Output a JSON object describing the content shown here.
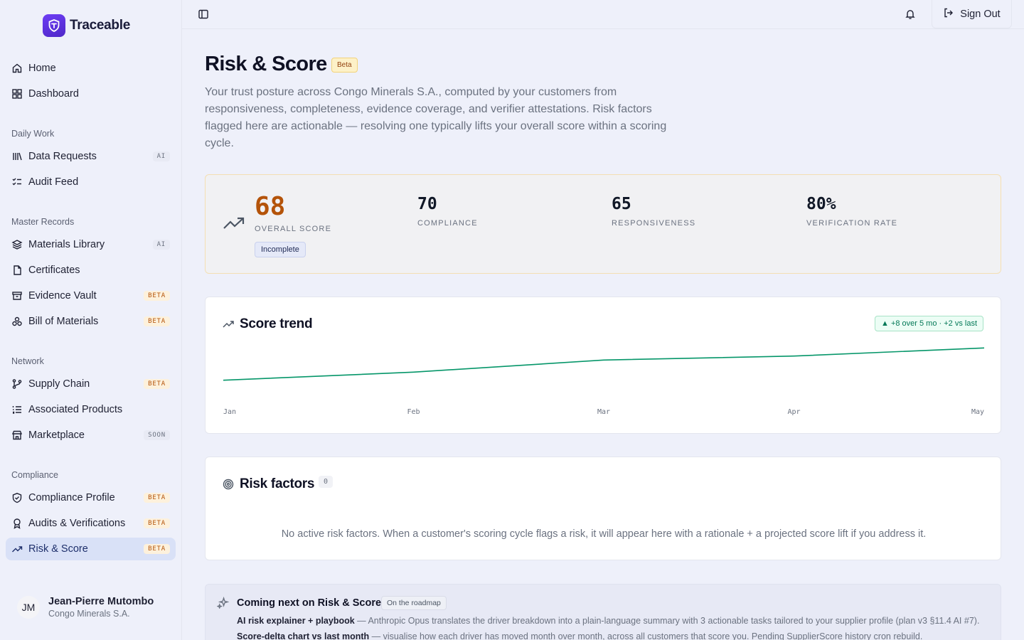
{
  "brand": {
    "name": "Traceable"
  },
  "nav": {
    "home": "Home",
    "dashboard": "Dashboard",
    "sections": {
      "daily_work": "Daily Work",
      "master_records": "Master Records",
      "network": "Network",
      "compliance": "Compliance"
    },
    "data_requests": {
      "label": "Data Requests",
      "badge": "AI"
    },
    "audit_feed": "Audit Feed",
    "materials_library": {
      "label": "Materials Library",
      "badge": "AI"
    },
    "certificates": "Certificates",
    "evidence_vault": {
      "label": "Evidence Vault",
      "badge": "BETA"
    },
    "bill_of_materials": {
      "label": "Bill of Materials",
      "badge": "BETA"
    },
    "supply_chain": {
      "label": "Supply Chain",
      "badge": "BETA"
    },
    "associated_products": "Associated Products",
    "marketplace": {
      "label": "Marketplace",
      "badge": "SOON"
    },
    "compliance_profile": {
      "label": "Compliance Profile",
      "badge": "BETA"
    },
    "audits_verifications": {
      "label": "Audits & Verifications",
      "badge": "BETA"
    },
    "risk_score": {
      "label": "Risk & Score",
      "badge": "BETA"
    }
  },
  "user": {
    "initials": "JM",
    "name": "Jean-Pierre Mutombo",
    "org": "Congo Minerals S.A."
  },
  "topbar": {
    "sign_out": "Sign Out"
  },
  "page": {
    "title": "Risk & Score",
    "title_badge": "Beta",
    "subtitle": "Your trust posture across Congo Minerals S.A., computed by your customers from responsiveness, completeness, evidence coverage, and verifier attestations. Risk factors flagged here are actionable — resolving one typically lifts your overall score within a scoring cycle."
  },
  "scores": {
    "overall": {
      "value": "68",
      "label": "OVERALL SCORE",
      "status": "Incomplete"
    },
    "compliance": {
      "value": "70",
      "label": "COMPLIANCE"
    },
    "responsiveness": {
      "value": "65",
      "label": "RESPONSIVENESS"
    },
    "verification": {
      "value": "80%",
      "label": "VERIFICATION RATE"
    }
  },
  "trend_card": {
    "title": "Score trend",
    "pill": "▲ +8 over 5 mo · +2 vs last"
  },
  "chart_data": {
    "type": "line",
    "categories": [
      "Jan",
      "Feb",
      "Mar",
      "Apr",
      "May"
    ],
    "series": [
      {
        "values": [
          60,
          62,
          65,
          66,
          68
        ]
      }
    ],
    "ylim": [
      55,
      70
    ],
    "color": "#059669",
    "grid": false
  },
  "risk_card": {
    "title": "Risk factors",
    "count": "0",
    "empty": "No active risk factors. When a customer's scoring cycle flags a risk, it will appear here with a rationale + a projected score lift if you address it."
  },
  "roadmap": {
    "title": "Coming next on Risk & Score",
    "chip": "On the roadmap",
    "items": [
      {
        "name": "AI risk explainer + playbook",
        "desc": " — Anthropic Opus translates the driver breakdown into a plain-language summary with 3 actionable tasks tailored to your supplier profile (plan v3 §11.4 AI #7)."
      },
      {
        "name": "Score-delta chart vs last month",
        "desc": " — visualise how each driver has moved month over month, across all customers that score you. Pending SupplierScore history cron rebuild."
      }
    ]
  }
}
